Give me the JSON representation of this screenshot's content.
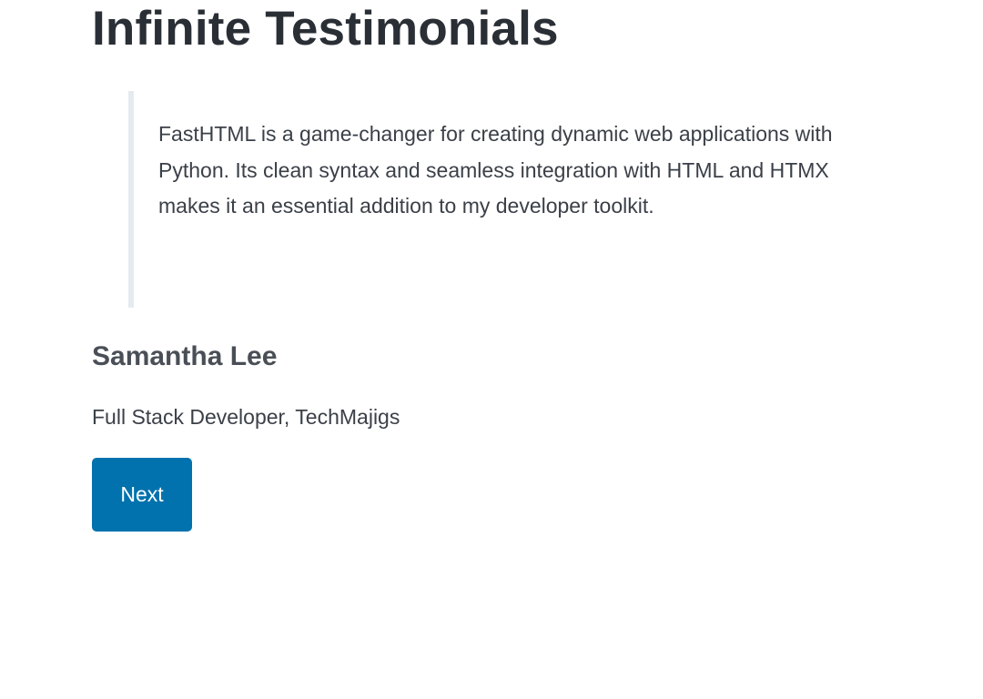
{
  "header": {
    "title": "Infinite Testimonials"
  },
  "testimonial": {
    "quote": "FastHTML is a game-changer for creating dynamic web applications with Python. Its clean syntax and seamless integration with HTML and HTMX makes it an essential addition to my developer toolkit.",
    "author_name": "Samantha Lee",
    "author_role": "Full Stack Developer, TechMajigs"
  },
  "controls": {
    "next_label": "Next"
  },
  "colors": {
    "button_background": "#0172ad",
    "button_text": "#ffffff",
    "quote_border": "#e5eaf0",
    "heading_text": "#2a2f36"
  }
}
